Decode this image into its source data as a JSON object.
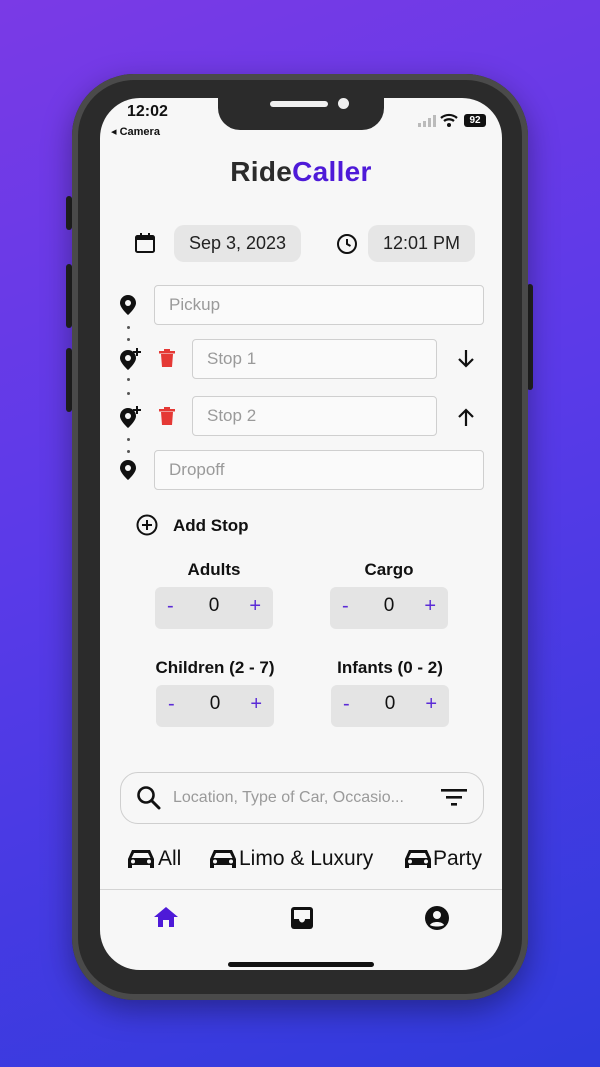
{
  "status_bar": {
    "time": "12:02",
    "back_label": "◂ Camera",
    "battery": "92"
  },
  "app": {
    "title_part1": "Ride",
    "title_part2": "Caller",
    "accent": "#4e1ad8"
  },
  "schedule": {
    "date": "Sep 3, 2023",
    "time": "12:01 PM"
  },
  "route": {
    "pickup_placeholder": "Pickup",
    "stop1_placeholder": "Stop 1",
    "stop2_placeholder": "Stop 2",
    "dropoff_placeholder": "Dropoff",
    "add_stop_label": "Add Stop"
  },
  "passengers": {
    "adults": {
      "label": "Adults",
      "minus": "-",
      "value": "0",
      "plus": "+"
    },
    "cargo": {
      "label": "Cargo",
      "minus": "-",
      "value": "0",
      "plus": "+"
    },
    "children": {
      "label": "Children (2 - 7)",
      "minus": "-",
      "value": "0",
      "plus": "+"
    },
    "infants": {
      "label": "Infants (0 - 2)",
      "minus": "-",
      "value": "0",
      "plus": "+"
    }
  },
  "search": {
    "placeholder": "Location, Type of Car, Occasio..."
  },
  "categories": [
    "All",
    "Limo & Luxury",
    "Party"
  ],
  "tabbar": {
    "active_color": "#4e1ad8"
  }
}
